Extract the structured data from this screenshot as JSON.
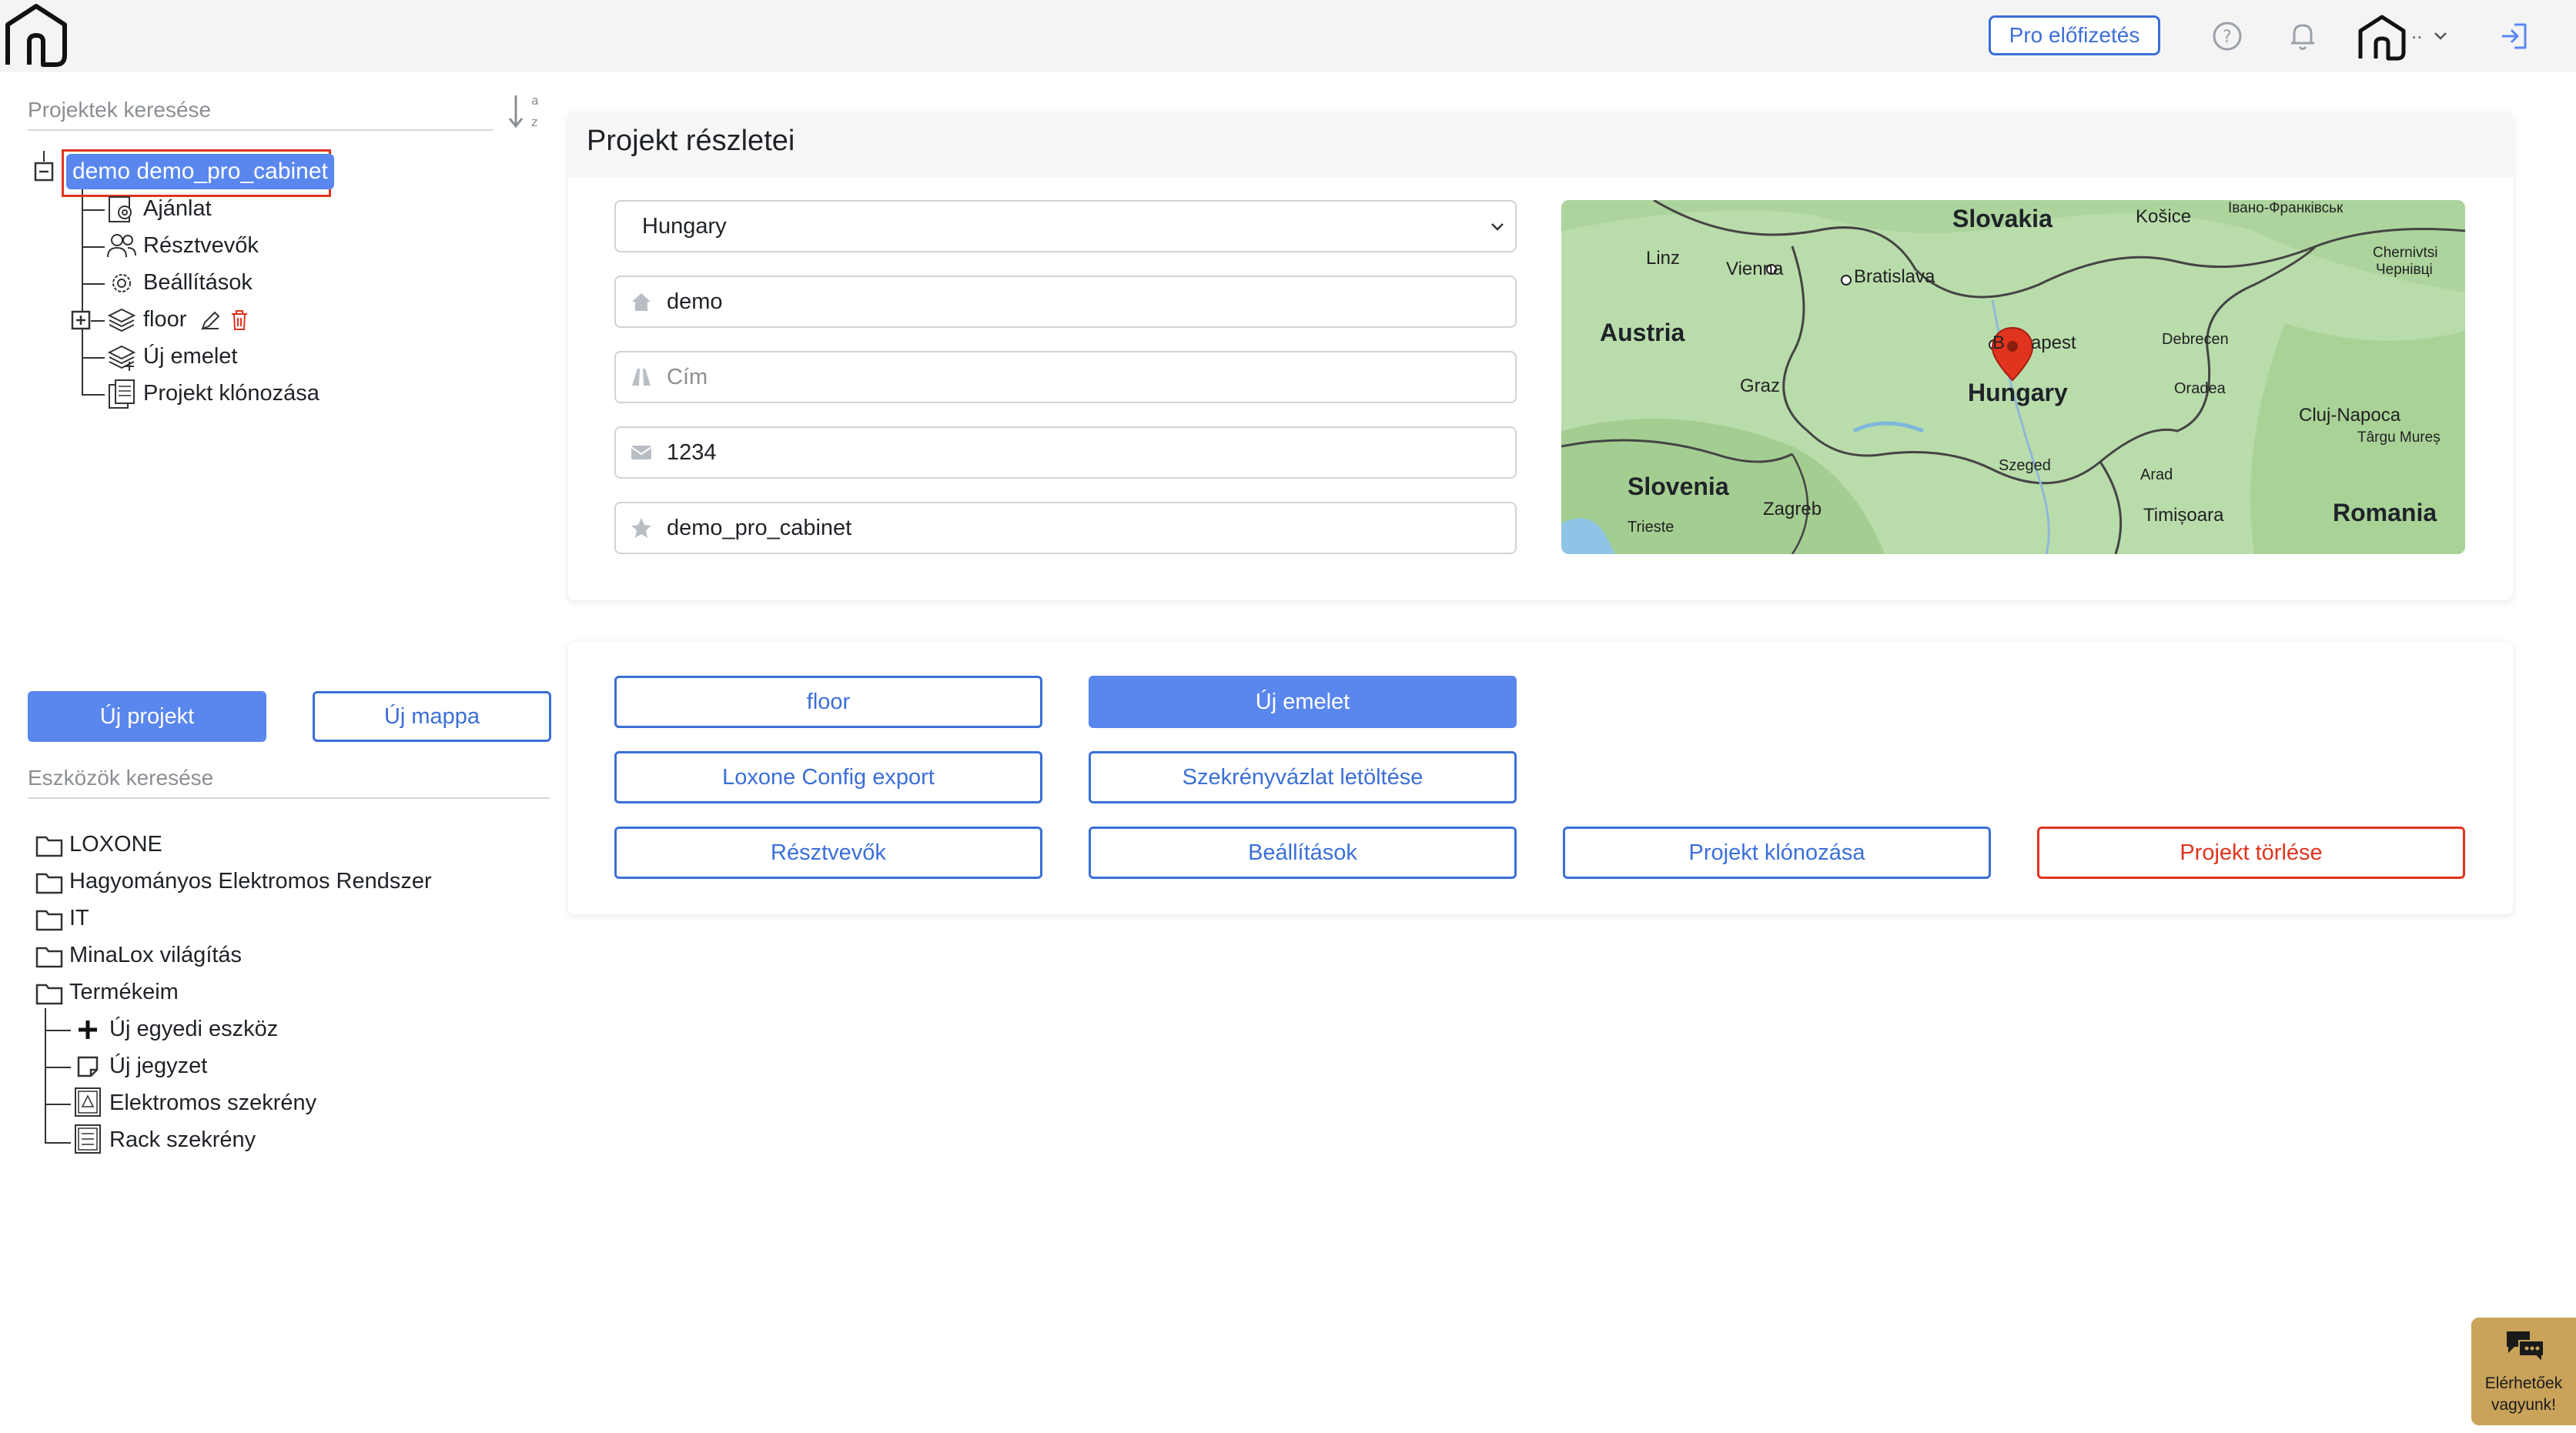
{
  "header": {
    "pro_label": "Pro előfizetés",
    "user_dots": "..",
    "icons": [
      "home-logo-icon",
      "help-icon",
      "bell-icon",
      "user-home-icon",
      "chevron-down-icon",
      "logout-icon"
    ]
  },
  "project_search": {
    "placeholder": "Projektek keresése"
  },
  "project_tree": {
    "root_label": "demo demo_pro_cabinet",
    "children": [
      {
        "label": "Ajánlat",
        "icon": "gear-doc-icon"
      },
      {
        "label": "Résztvevők",
        "icon": "users-icon"
      },
      {
        "label": "Beállítások",
        "icon": "gear-icon"
      },
      {
        "label": "floor",
        "icon": "layers-icon"
      },
      {
        "label": "Új emelet",
        "icon": "layers-add-icon"
      },
      {
        "label": "Projekt klónozása",
        "icon": "clone-icon"
      }
    ]
  },
  "left_buttons": {
    "new_project": "Új projekt",
    "new_folder": "Új mappa"
  },
  "tools_search": {
    "placeholder": "Eszközök keresése"
  },
  "tools_tree": {
    "folders": [
      "LOXONE",
      "Hagyományos Elektromos Rendszer",
      "IT",
      "MinaLox világítás",
      "Termékeim"
    ],
    "products": [
      "Új egyedi eszköz",
      "Új jegyzet",
      "Elektromos szekrény",
      "Rack szekrény"
    ]
  },
  "details": {
    "title": "Projekt részletei",
    "country": "Hungary",
    "name": "demo",
    "address_placeholder": "Cím",
    "zip": "1234",
    "project_id": "demo_pro_cabinet"
  },
  "map": {
    "countries": [
      "Slovakia",
      "Austria",
      "Hungary",
      "Slovenia",
      "Romania"
    ],
    "cities": [
      "Linz",
      "Vienna",
      "Bratislava",
      "Košice",
      "Івано-Франківськ",
      "Chernivtsi",
      "Чернівці",
      "Graz",
      "Debrecen",
      "Oradea",
      "Cluj-Napoca",
      "Târgu Mureș",
      "Szeged",
      "Arad",
      "Zagreb",
      "Trieste",
      "Timișoara",
      "B",
      "apest"
    ]
  },
  "actions": {
    "floor": "floor",
    "new_floor": "Új emelet",
    "loxone_export": "Loxone Config export",
    "cabinet_download": "Szekrényvázlat letöltése",
    "participants": "Résztvevők",
    "settings": "Beállítások",
    "clone": "Projekt klónozása",
    "delete": "Projekt törlése"
  },
  "chat": {
    "line1": "Elérhetőek",
    "line2": "vagyunk!"
  },
  "colors": {
    "primary": "#5a87ee",
    "outline": "#3b6fd8",
    "danger": "#e0341e",
    "chat": "#c9a35a"
  }
}
